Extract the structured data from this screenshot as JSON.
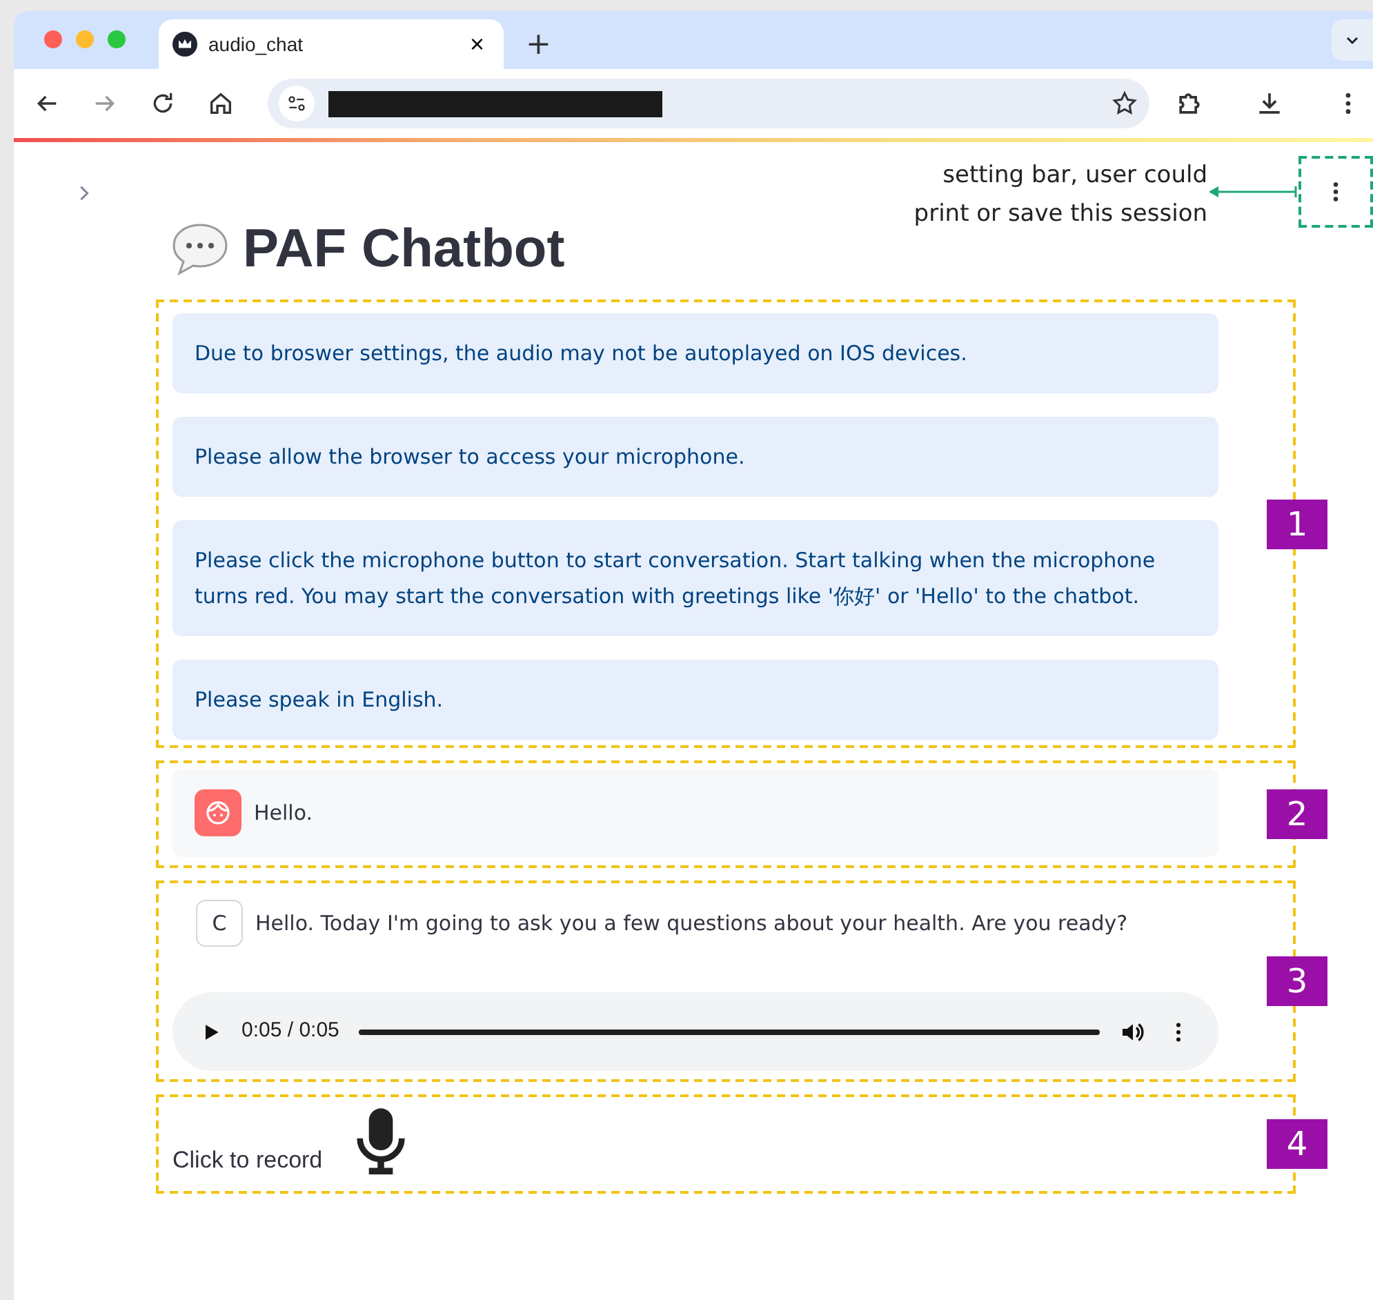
{
  "browser": {
    "tab": {
      "title": "audio_chat",
      "close": "×"
    },
    "new_tab": "+"
  },
  "annotation": {
    "text": "setting bar, user could print or save this session"
  },
  "app": {
    "title": "PAF Chatbot"
  },
  "sections": [
    {
      "number": "1",
      "kind": "info",
      "messages": [
        "Due to broswer settings, the audio may not be autoplayed on IOS devices.",
        "Please allow the browser to access your microphone.",
        "Please click the microphone button to start conversation. Start talking when the microphone turns red. You may start the conversation with greetings like '你好' or 'Hello' to the chatbot.",
        "Please speak in English."
      ]
    },
    {
      "number": "2",
      "kind": "user",
      "text": "Hello."
    },
    {
      "number": "3",
      "kind": "assistant",
      "avatar": "C",
      "text": "Hello. Today I'm going to ask you a few questions about your health. Are you ready?",
      "audio": {
        "time": "0:05 / 0:05",
        "level": 1
      }
    },
    {
      "number": "4",
      "kind": "recorder",
      "label": "Click to record"
    }
  ]
}
